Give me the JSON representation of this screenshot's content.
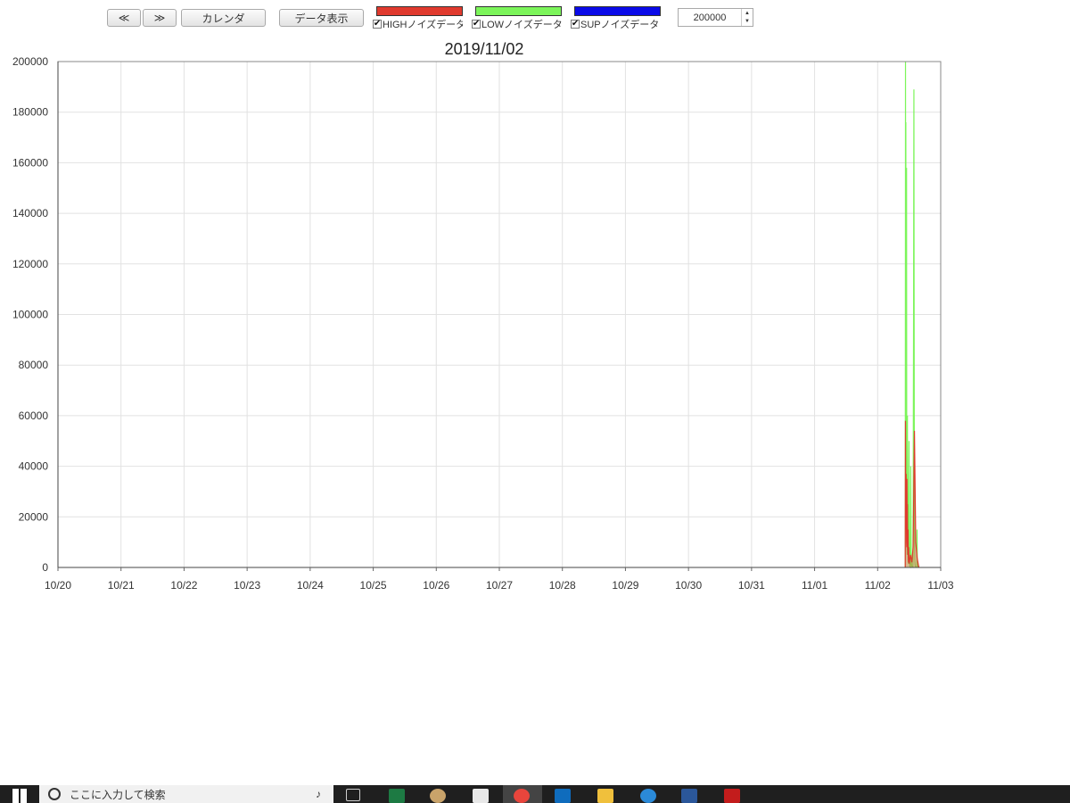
{
  "toolbar": {
    "prev_label": "≪",
    "next_label": "≫",
    "calendar_label": "カレンダ",
    "data_display_label": "データ表示",
    "spinner_value": "200000"
  },
  "legend": [
    {
      "label": "HIGHノイズデータ",
      "color": "#e03a2e",
      "checked": true
    },
    {
      "label": "LOWノイズデータ",
      "color": "#7cf55a",
      "checked": true
    },
    {
      "label": "SUPノイズデータ",
      "color": "#0a0ae8",
      "checked": true
    }
  ],
  "taskbar": {
    "search_placeholder": "ここに入力して検索"
  },
  "chart_data": {
    "type": "line",
    "title": "2019/11/02",
    "xlabel": "",
    "ylabel": "",
    "x_ticks": [
      "10/20",
      "10/21",
      "10/22",
      "10/23",
      "10/24",
      "10/25",
      "10/26",
      "10/27",
      "10/28",
      "10/29",
      "10/30",
      "10/31",
      "11/01",
      "11/02",
      "11/03"
    ],
    "y_ticks": [
      "200000",
      "180000",
      "160000",
      "140000",
      "120000",
      "100000",
      "80000",
      "60000",
      "40000",
      "20000",
      "0"
    ],
    "xlim": [
      "2019-10-20",
      "2019-11-03"
    ],
    "ylim": [
      0,
      200000
    ],
    "grid": true,
    "series": [
      {
        "name": "LOWノイズデータ",
        "color": "#7cf55a",
        "x": [
          "2019-11-02 10:30",
          "2019-11-02 10:33",
          "2019-11-02 10:36",
          "2019-11-02 10:40",
          "2019-11-02 10:44",
          "2019-11-02 10:48",
          "2019-11-02 10:52",
          "2019-11-02 10:56",
          "2019-11-02 11:00",
          "2019-11-02 11:04",
          "2019-11-02 11:08",
          "2019-11-02 11:12",
          "2019-11-02 11:16",
          "2019-11-02 11:20",
          "2019-11-02 11:24",
          "2019-11-02 11:28",
          "2019-11-02 11:32",
          "2019-11-02 11:36",
          "2019-11-02 11:40",
          "2019-11-02 11:44",
          "2019-11-02 11:48",
          "2019-11-02 11:52",
          "2019-11-02 11:56",
          "2019-11-02 12:00",
          "2019-11-02 12:04",
          "2019-11-02 12:08",
          "2019-11-02 12:12",
          "2019-11-02 12:16",
          "2019-11-02 12:20",
          "2019-11-02 12:24",
          "2019-11-02 12:28",
          "2019-11-02 12:32",
          "2019-11-02 12:36",
          "2019-11-02 12:40",
          "2019-11-02 12:44",
          "2019-11-02 12:48",
          "2019-11-02 12:52",
          "2019-11-02 12:56",
          "2019-11-02 13:00",
          "2019-11-02 13:04",
          "2019-11-02 13:08",
          "2019-11-02 13:12",
          "2019-11-02 13:16",
          "2019-11-02 13:20",
          "2019-11-02 13:24",
          "2019-11-02 13:28",
          "2019-11-02 13:32",
          "2019-11-02 13:36",
          "2019-11-02 13:40",
          "2019-11-02 13:44",
          "2019-11-02 13:48",
          "2019-11-02 13:52",
          "2019-11-02 13:56",
          "2019-11-02 14:00",
          "2019-11-02 14:04",
          "2019-11-02 14:08",
          "2019-11-02 14:12",
          "2019-11-02 14:16",
          "2019-11-02 14:20",
          "2019-11-02 14:24",
          "2019-11-02 14:28",
          "2019-11-02 14:32",
          "2019-11-02 14:36",
          "2019-11-02 14:40",
          "2019-11-02 14:44",
          "2019-11-02 14:48",
          "2019-11-02 14:52",
          "2019-11-02 14:56",
          "2019-11-02 15:00",
          "2019-11-02 15:04",
          "2019-11-02 15:08",
          "2019-11-02 15:12",
          "2019-11-02 15:16",
          "2019-11-02 15:20",
          "2019-11-02 15:24",
          "2019-11-02 15:28",
          "2019-11-02 15:32",
          "2019-11-02 15:36",
          "2019-11-02 15:40",
          "2019-11-02 15:44"
        ],
        "values": [
          0,
          85000,
          200000,
          120000,
          176000,
          60000,
          30000,
          15000,
          158000,
          40000,
          20000,
          10000,
          5000,
          60000,
          30000,
          12000,
          6000,
          3000,
          1500,
          5000,
          10000,
          35000,
          50000,
          20000,
          8000,
          3000,
          1000,
          500,
          200,
          100,
          50,
          20000,
          40000,
          25000,
          10000,
          4000,
          2000,
          1000,
          500,
          300,
          200,
          100,
          50,
          30,
          20,
          10000,
          30000,
          65000,
          95000,
          150000,
          189000,
          120000,
          60000,
          25000,
          10000,
          5000,
          2000,
          1000,
          500,
          300,
          200,
          100,
          80,
          60,
          40,
          20,
          10,
          10000,
          15000,
          5000,
          2000,
          1000,
          500,
          200,
          100,
          50,
          20,
          10,
          5,
          0
        ]
      },
      {
        "name": "HIGHノイズデータ",
        "color": "#e03a2e",
        "x": [
          "2019-11-02 10:30",
          "2019-11-02 10:35",
          "2019-11-02 10:40",
          "2019-11-02 10:45",
          "2019-11-02 10:50",
          "2019-11-02 10:55",
          "2019-11-02 11:00",
          "2019-11-02 11:05",
          "2019-11-02 11:10",
          "2019-11-02 11:15",
          "2019-11-02 11:20",
          "2019-11-02 11:25",
          "2019-11-02 11:30",
          "2019-11-02 11:35",
          "2019-11-02 11:40",
          "2019-11-02 11:45",
          "2019-11-02 11:50",
          "2019-11-02 11:55",
          "2019-11-02 12:00",
          "2019-11-02 12:30",
          "2019-11-02 13:00",
          "2019-11-02 13:30",
          "2019-11-02 14:00",
          "2019-11-02 14:30",
          "2019-11-02 15:00",
          "2019-11-02 15:30",
          "2019-11-02 15:44"
        ],
        "values": [
          0,
          58000,
          30000,
          15000,
          37000,
          20000,
          10000,
          8000,
          35000,
          15000,
          25000,
          8000,
          5000,
          15000,
          4000,
          2000,
          8000,
          3000,
          1500,
          5000,
          2000,
          8000,
          54000,
          10000,
          4000,
          1000,
          0
        ]
      },
      {
        "name": "SUPノイズデータ",
        "color": "#0a0ae8",
        "x": [],
        "values": []
      }
    ]
  }
}
